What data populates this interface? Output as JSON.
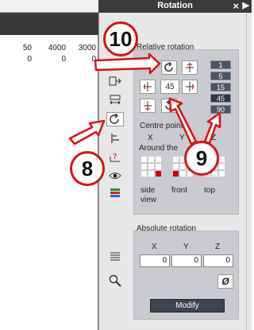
{
  "window": {
    "title": "Rotation",
    "close": "×",
    "collapse": "▶"
  },
  "doc": {
    "row1": [
      "50",
      "4000",
      "3000"
    ],
    "row2": [
      "0",
      "0",
      "0"
    ]
  },
  "toolbar": {
    "icons": [
      "insert-arrow-icon",
      "resize-icon",
      "rotate-icon",
      "align-icon",
      "help-axis-icon",
      "eye-icon",
      "color-bars-icon",
      "list-icon",
      "zoom-icon"
    ]
  },
  "relative": {
    "title": "Relative rotation",
    "angle": "45",
    "steps": [
      "1",
      "5",
      "15",
      "45",
      "90"
    ],
    "selected_step": "45",
    "centre_points": "Centre points",
    "axes": [
      "X",
      "Y",
      "Z"
    ],
    "around": "Around the",
    "views": [
      "side view",
      "front",
      "top"
    ]
  },
  "absolute": {
    "title": "Absolute rotation",
    "axes": [
      "X",
      "Y",
      "Z"
    ],
    "values": [
      "0",
      "0",
      "0"
    ],
    "reset_label": "Ø",
    "modify": "Modify"
  },
  "callouts": {
    "c10": "10",
    "c8": "8",
    "c9": "9"
  },
  "colors": {
    "callout": "#dd1111",
    "panel": "#e7e7e7",
    "titlebar": "#3b3b3b"
  }
}
